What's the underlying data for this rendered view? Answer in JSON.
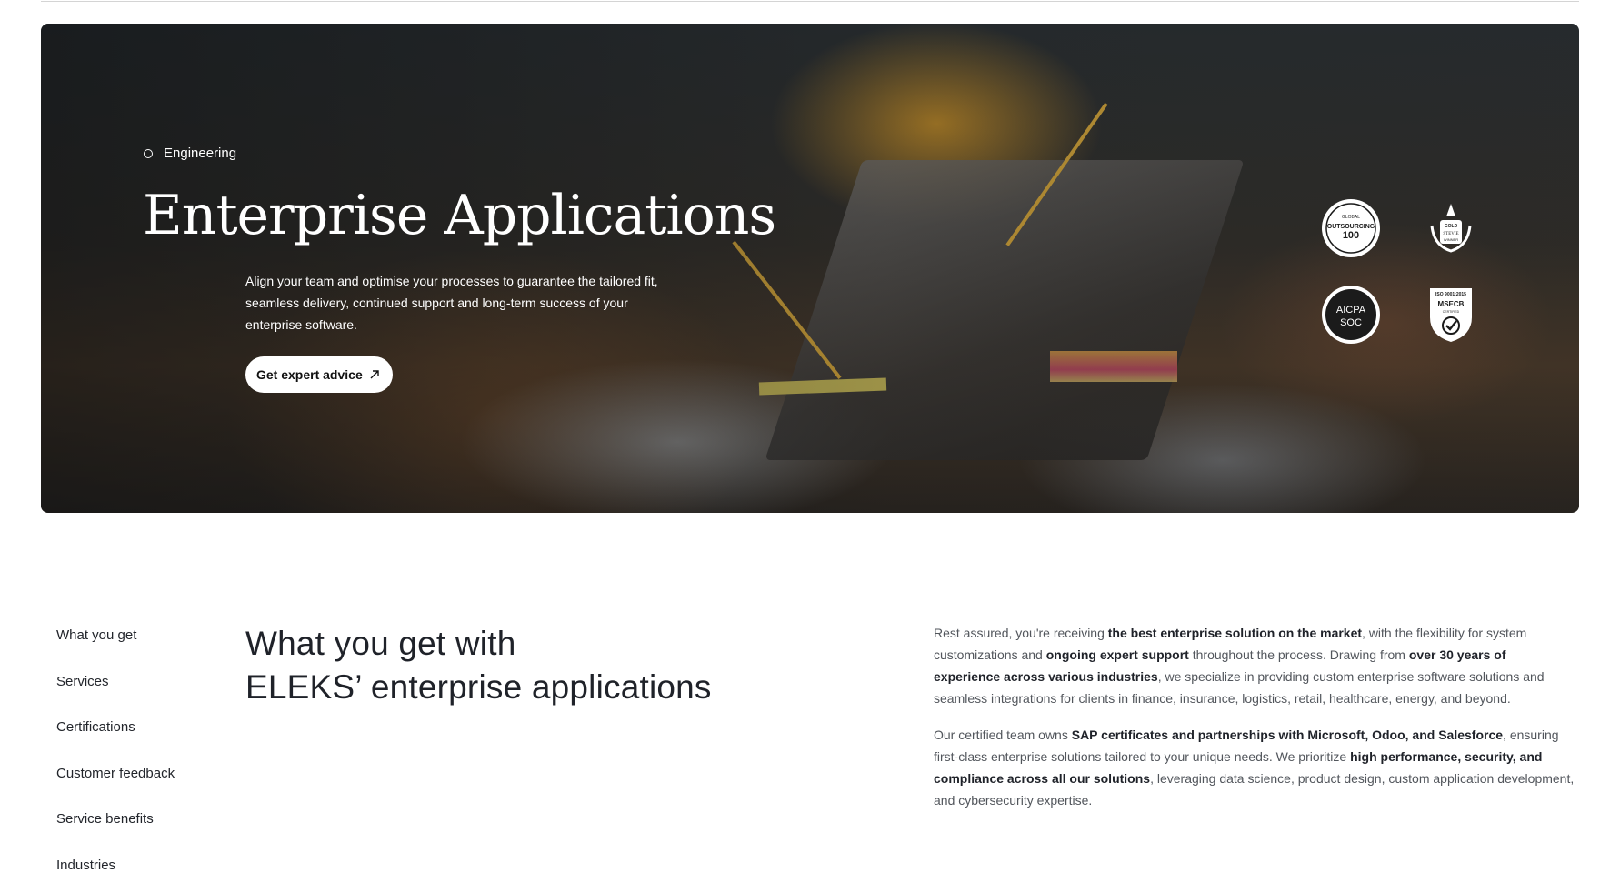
{
  "hero": {
    "eyebrow": "Engineering",
    "title": "Enterprise Applications",
    "description": "Align your team and optimise your processes to guarantee the tailored fit, seamless delivery, continued support and long-term success of your enterprise software.",
    "cta_label": "Get expert advice",
    "cta_icon": "arrow-up-right-icon",
    "badges": [
      {
        "name": "outsourcing-100-badge",
        "line1": "GLOBAL",
        "line2": "OUTSOURCING",
        "line3": "100"
      },
      {
        "name": "gold-stevie-winner-badge",
        "line1": "GOLD",
        "line2": "STEVIE",
        "line3": "WINNER"
      },
      {
        "name": "aicpa-soc-badge",
        "line1": "AICPA",
        "line2": "SOC"
      },
      {
        "name": "iso-9001-badge",
        "line1": "ISO 9001:2015",
        "line2": "MSECB",
        "line3": "CERTIFIED"
      }
    ]
  },
  "side_nav": {
    "items": [
      "What you get",
      "Services",
      "Certifications",
      "Customer feedback",
      "Service benefits",
      "Industries"
    ]
  },
  "section": {
    "heading_line1": "What you get with",
    "heading_line2": "ELEKS’ enterprise applications"
  },
  "body": {
    "p1": [
      {
        "t": "Rest assured, you're receiving ",
        "b": false
      },
      {
        "t": "the best enterprise solution on the market",
        "b": true
      },
      {
        "t": ", with the flexibility for system customizations and ",
        "b": false
      },
      {
        "t": "ongoing expert support",
        "b": true
      },
      {
        "t": " throughout the process. Drawing from ",
        "b": false
      },
      {
        "t": "over 30 years of experience across various industries",
        "b": true
      },
      {
        "t": ", we specialize in providing custom enterprise software solutions and seamless integrations for clients in finance, insurance, logistics, retail, healthcare, energy, and beyond.",
        "b": false
      }
    ],
    "p2": [
      {
        "t": "Our certified team owns ",
        "b": false
      },
      {
        "t": "SAP certificates and partnerships with Microsoft, Odoo, and Salesforce",
        "b": true
      },
      {
        "t": ", ensuring first-class enterprise solutions tailored to your unique needs. We prioritize ",
        "b": false
      },
      {
        "t": "high performance, security, and compliance across all our solutions",
        "b": true
      },
      {
        "t": ", leveraging data science, product design, custom application development, and cybersecurity expertise.",
        "b": false
      }
    ]
  },
  "colors": {
    "text_primary": "#1f2229",
    "text_secondary": "#52565c",
    "cta_background": "#ffffff"
  }
}
